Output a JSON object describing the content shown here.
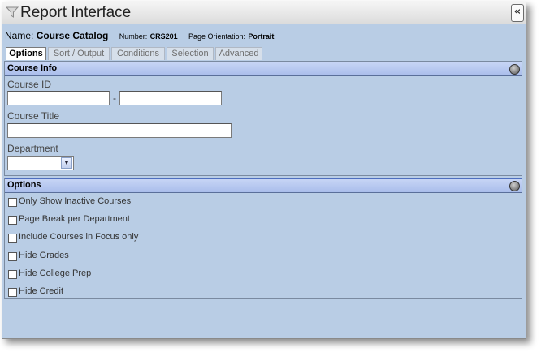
{
  "window": {
    "title": "Report Interface",
    "collapse_label": "«"
  },
  "report": {
    "name_label": "Name:",
    "name_value": "Course Catalog",
    "number_label": "Number:",
    "number_value": "CRS201",
    "orientation_label": "Page Orientation:",
    "orientation_value": "Portrait"
  },
  "tabs": [
    {
      "label": "Options",
      "active": true
    },
    {
      "label": "Sort / Output",
      "active": false
    },
    {
      "label": "Conditions",
      "active": false
    },
    {
      "label": "Selection",
      "active": false
    },
    {
      "label": "Advanced",
      "active": false
    }
  ],
  "course_info": {
    "title": "Course Info",
    "course_id_label": "Course ID",
    "course_id_from": "",
    "course_id_to": "",
    "separator": "-",
    "course_title_label": "Course Title",
    "course_title_value": "",
    "department_label": "Department",
    "department_value": ""
  },
  "options": {
    "title": "Options",
    "items": [
      {
        "label": "Only Show Inactive Courses",
        "checked": false
      },
      {
        "label": "Page Break per Department",
        "checked": false
      },
      {
        "label": "Include Courses in Focus only",
        "checked": false
      },
      {
        "label": "Hide Grades",
        "checked": false
      },
      {
        "label": "Hide College Prep",
        "checked": false
      },
      {
        "label": "Hide Credit",
        "checked": false
      }
    ]
  }
}
